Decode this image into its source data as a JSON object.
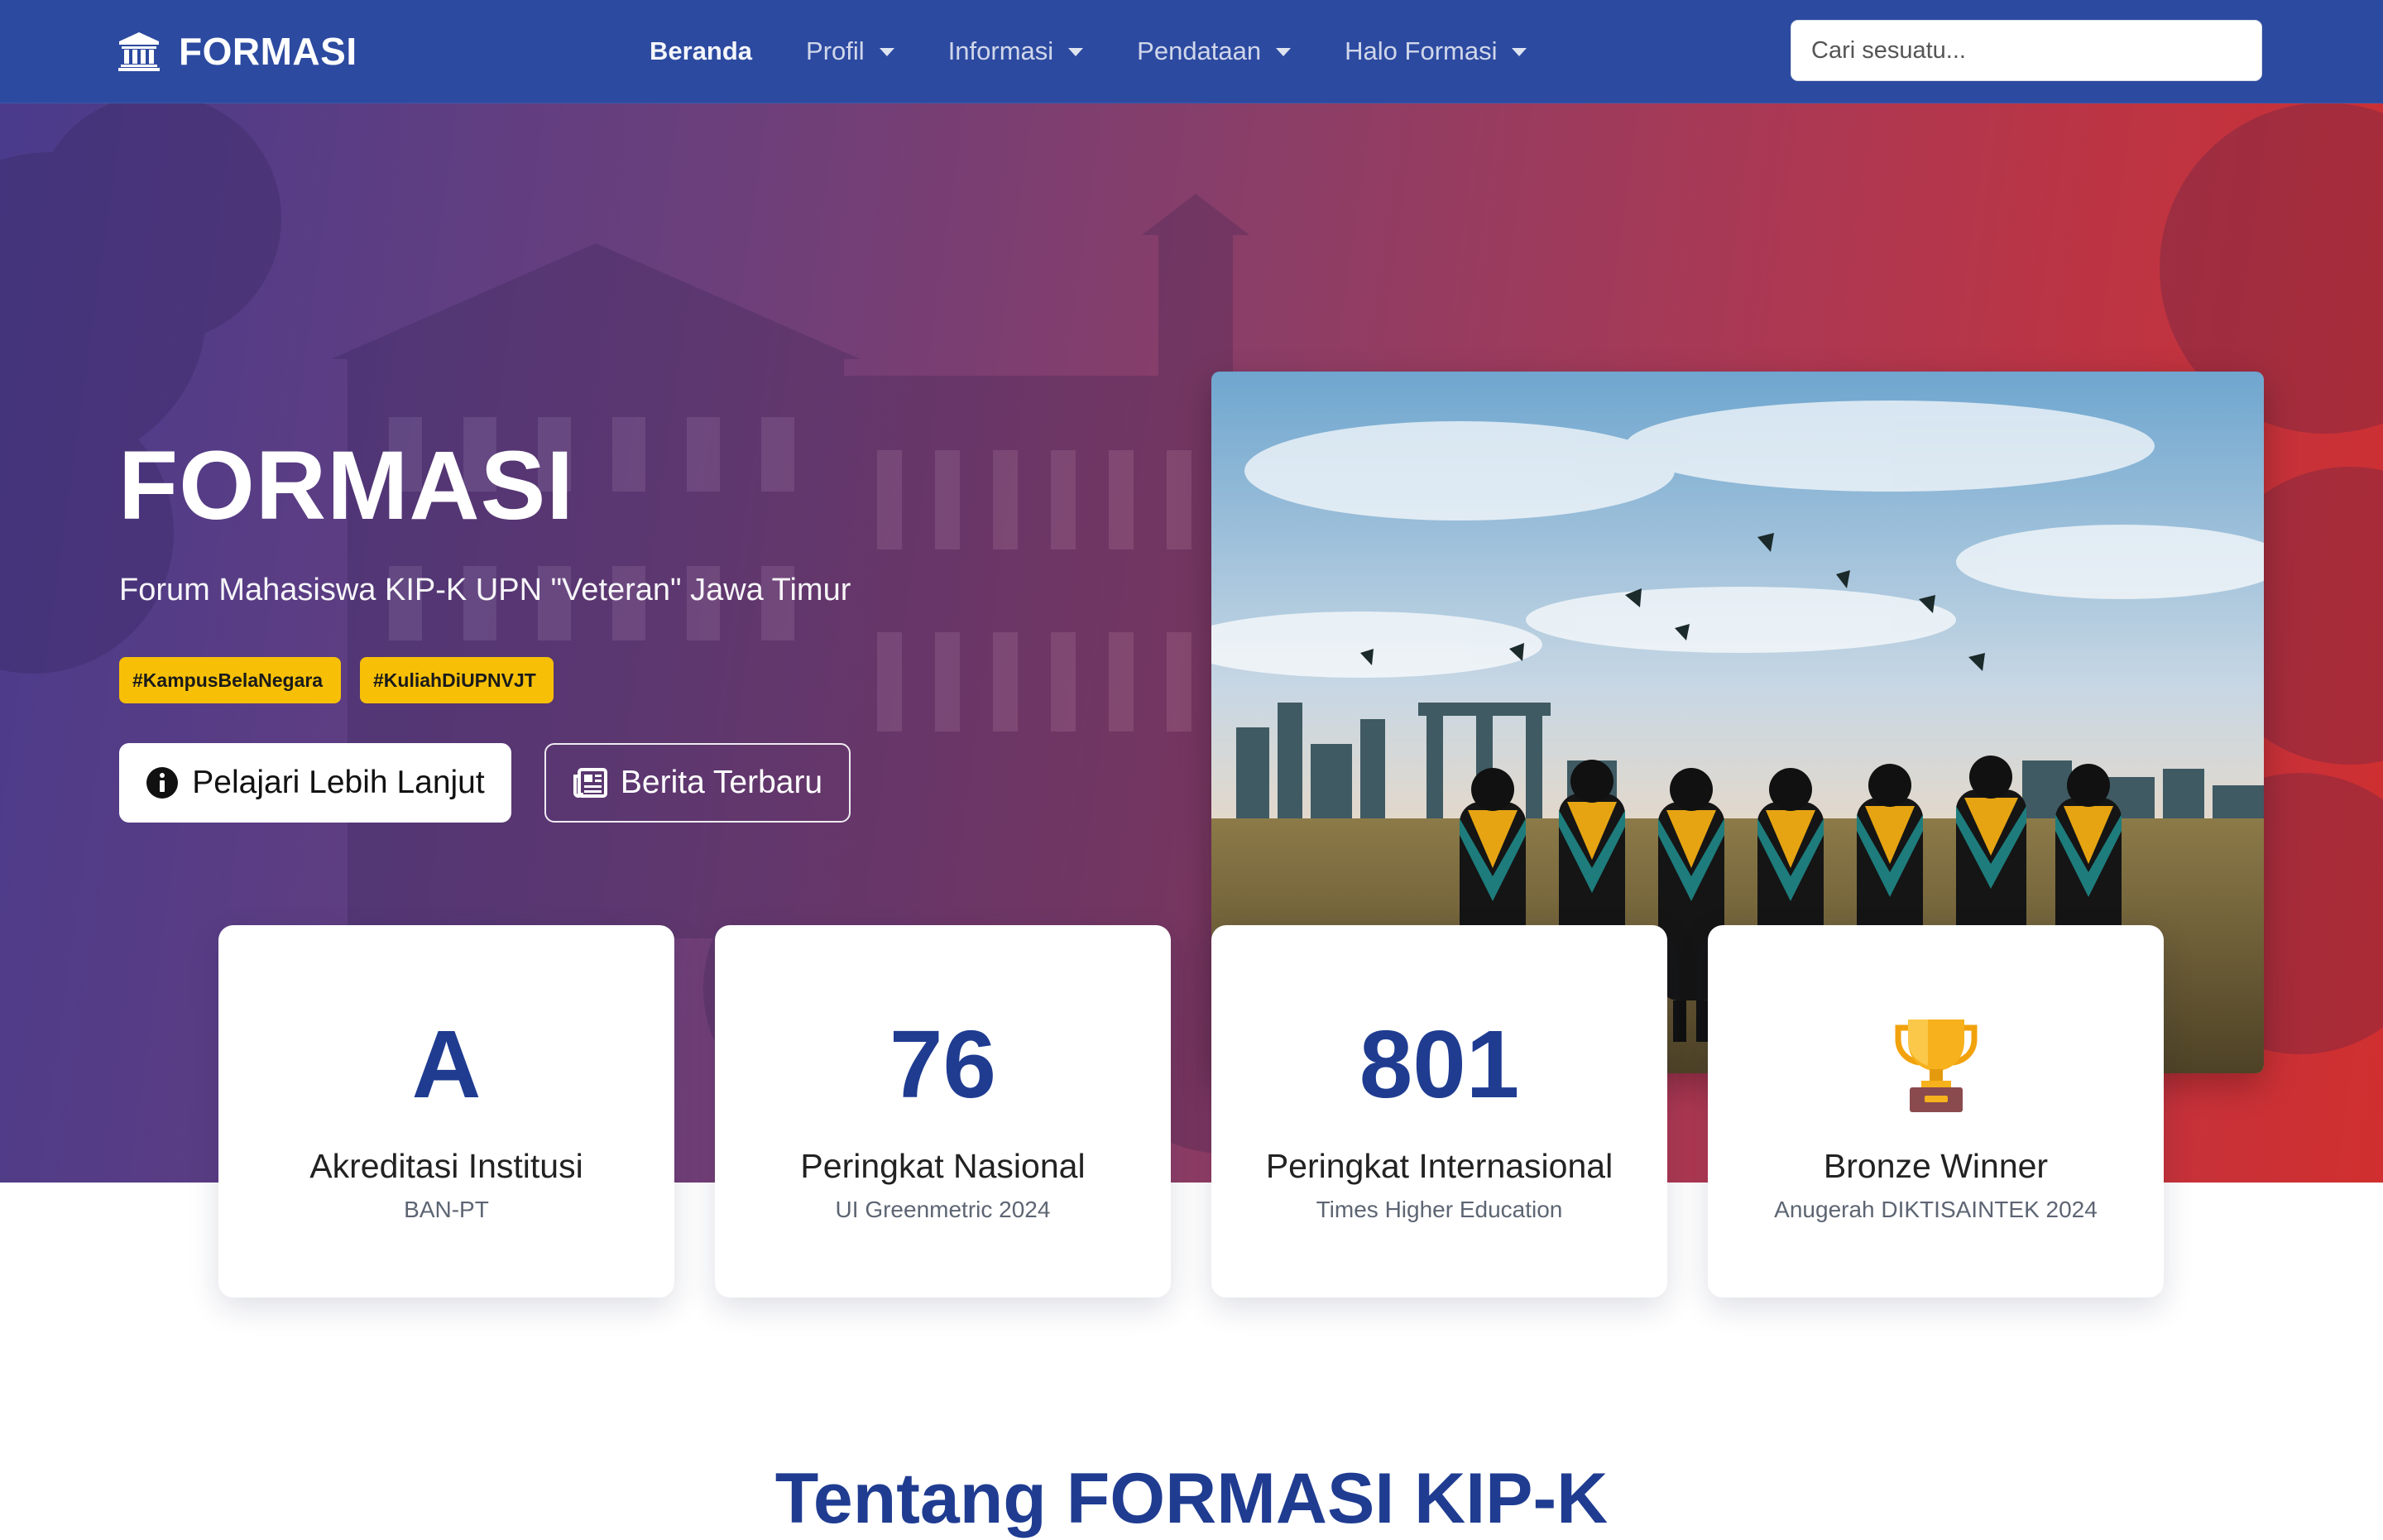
{
  "navbar": {
    "brand": "FORMASI",
    "items": [
      {
        "label": "Beranda"
      },
      {
        "label": "Profil"
      },
      {
        "label": "Informasi"
      },
      {
        "label": "Pendataan"
      },
      {
        "label": "Halo Formasi"
      }
    ],
    "search_placeholder": "Cari sesuatu..."
  },
  "hero": {
    "title": "FORMASI",
    "subtitle": "Forum Mahasiswa KIP-K UPN \"Veteran\" Jawa Timur",
    "tags": [
      "#KampusBelaNegara",
      "#KuliahDiUPNVJT"
    ],
    "primary_button": "Pelajari Lebih Lanjut",
    "secondary_button": "Berita Terbaru"
  },
  "stats": [
    {
      "value": "A",
      "label": "Akreditasi Institusi",
      "sub": "BAN-PT"
    },
    {
      "value": "76",
      "label": "Peringkat Nasional",
      "sub": "UI Greenmetric 2024"
    },
    {
      "value": "801",
      "label": "Peringkat Internasional",
      "sub": "Times Higher Education"
    },
    {
      "icon": "trophy-icon",
      "label": "Bronze Winner",
      "sub": "Anugerah DIKTISAINTEK 2024"
    }
  ],
  "about": {
    "title": "Tentang FORMASI KIP-K"
  },
  "colors": {
    "navbar": "#2c4aa0",
    "primary": "#1f3c91",
    "tag": "#f7c007",
    "hero_gradient_start": "#4a3b8c",
    "hero_gradient_end": "#d12f2f"
  }
}
